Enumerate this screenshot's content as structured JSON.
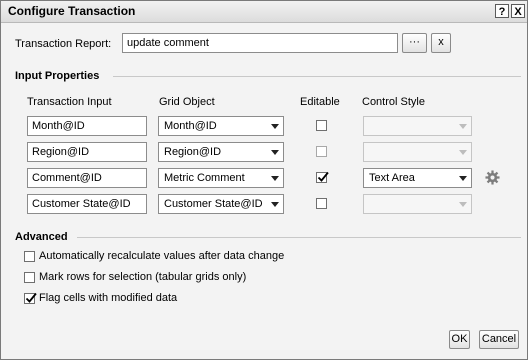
{
  "dialog": {
    "title": "Configure Transaction",
    "help_label": "?",
    "close_label": "X"
  },
  "report": {
    "label": "Transaction Report:",
    "value": "update comment",
    "browse_label": "···",
    "clear_label": "x"
  },
  "input_properties": {
    "heading": "Input Properties",
    "columns": [
      "Transaction Input",
      "Grid Object",
      "Editable",
      "Control Style"
    ],
    "rows": [
      {
        "input": "Month@ID",
        "grid_object": "Month@ID",
        "editable": false,
        "control_style": "",
        "settings_icon": false
      },
      {
        "input": "Region@ID",
        "grid_object": "Region@ID",
        "editable": false,
        "control_style": "",
        "settings_icon": false
      },
      {
        "input": "Comment@ID",
        "grid_object": "Metric Comment",
        "editable": true,
        "control_style": "Text Area",
        "settings_icon": true
      },
      {
        "input": "Customer State@ID",
        "grid_object": "Customer State@ID",
        "editable": false,
        "control_style": "",
        "settings_icon": false
      }
    ]
  },
  "advanced": {
    "heading": "Advanced",
    "options": [
      {
        "label": "Automatically recalculate values after data change",
        "checked": false
      },
      {
        "label": "Mark rows for selection (tabular grids only)",
        "checked": false
      },
      {
        "label": "Flag cells with modified data",
        "checked": true
      }
    ]
  },
  "footer": {
    "ok_label": "OK",
    "cancel_label": "Cancel"
  }
}
